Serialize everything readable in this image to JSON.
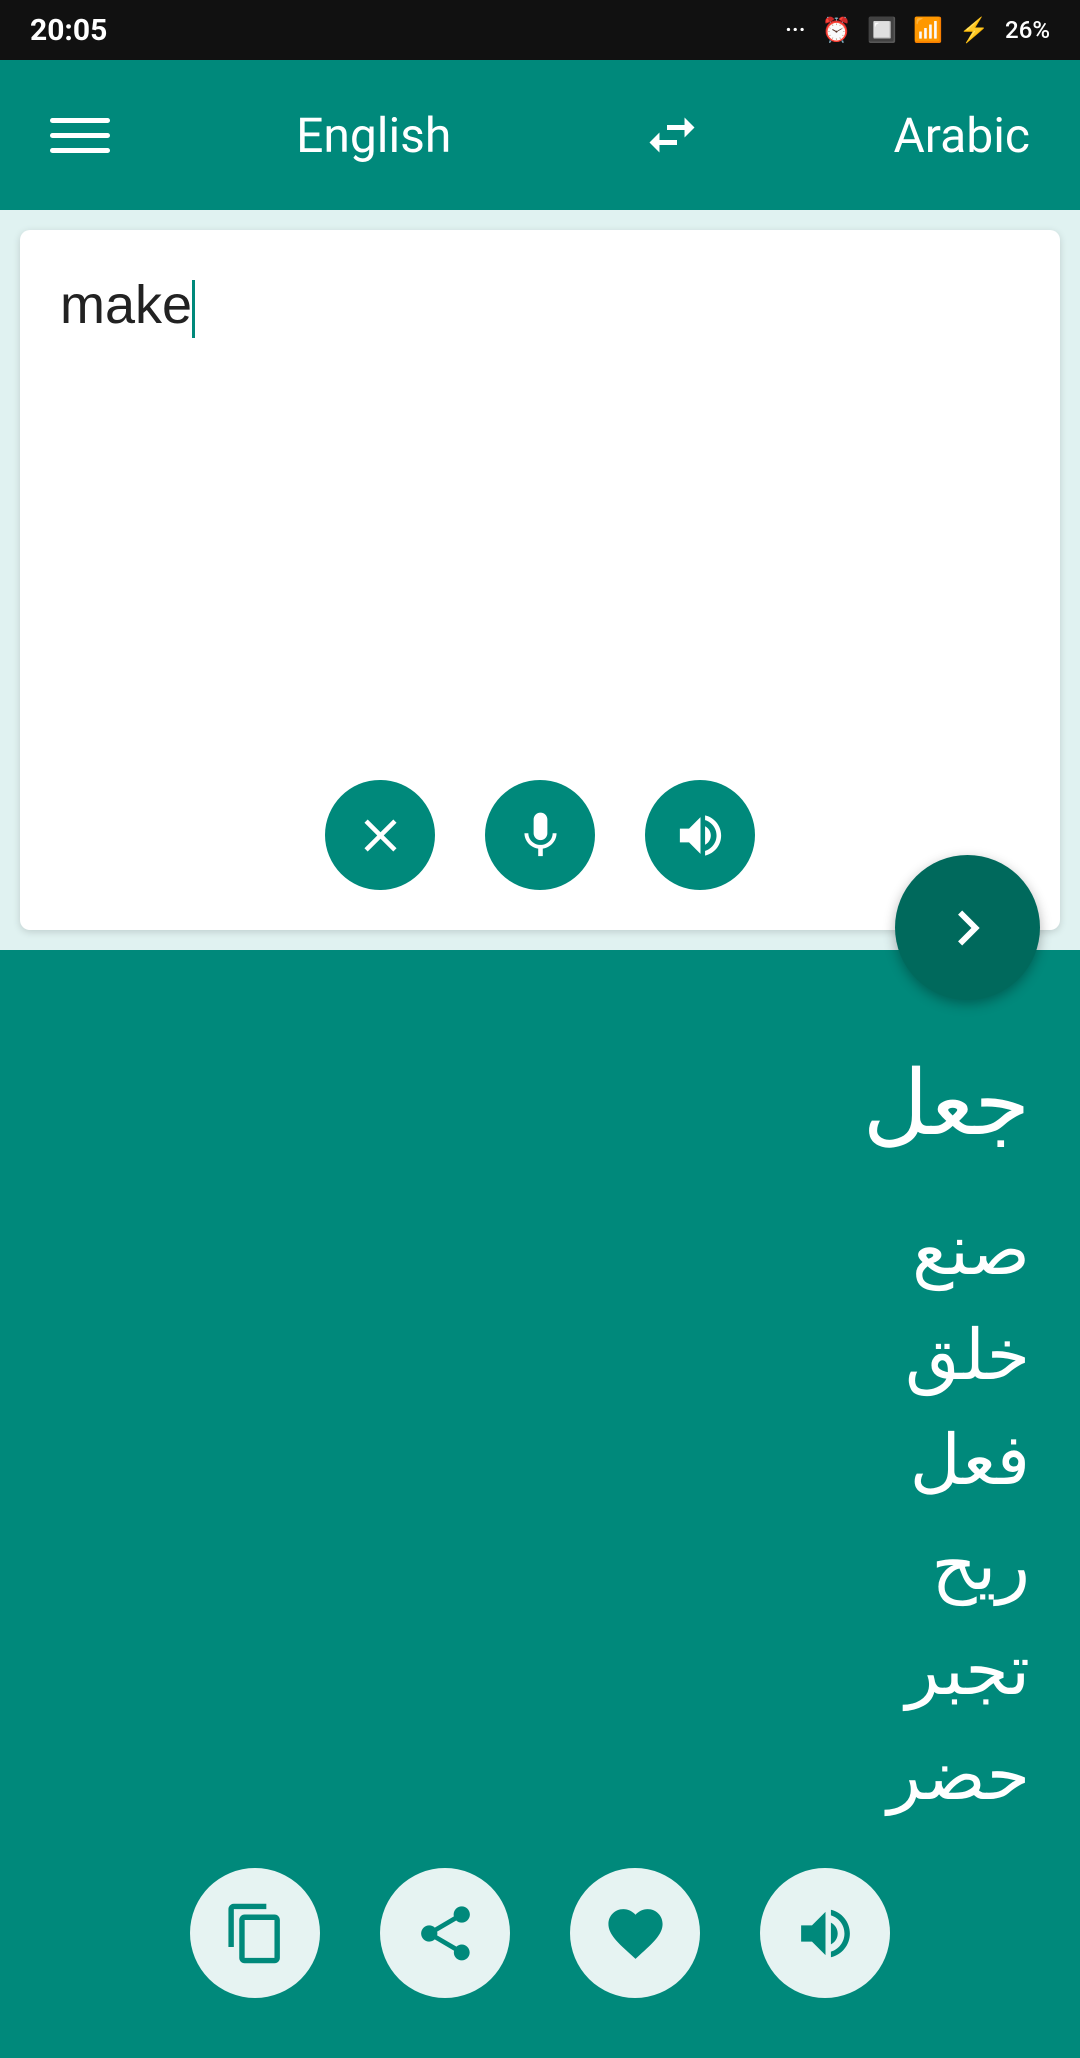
{
  "statusBar": {
    "time": "20:05",
    "battery": "26%"
  },
  "navbar": {
    "menuIconLabel": "menu",
    "sourceLang": "English",
    "swapIconLabel": "swap languages",
    "targetLang": "Arabic"
  },
  "inputSection": {
    "placeholder": "",
    "currentText": "make",
    "clearButtonLabel": "clear",
    "micButtonLabel": "microphone",
    "speakButtonLabel": "speak input"
  },
  "translateButton": {
    "label": "translate"
  },
  "outputSection": {
    "mainTranslation": "جعل",
    "alternatives": "صنع\nخلق\nفعل\nريح\nتجبر\nحضر",
    "copyButtonLabel": "copy",
    "shareButtonLabel": "share",
    "favoriteButtonLabel": "favorite",
    "speakButtonLabel": "speak output"
  }
}
